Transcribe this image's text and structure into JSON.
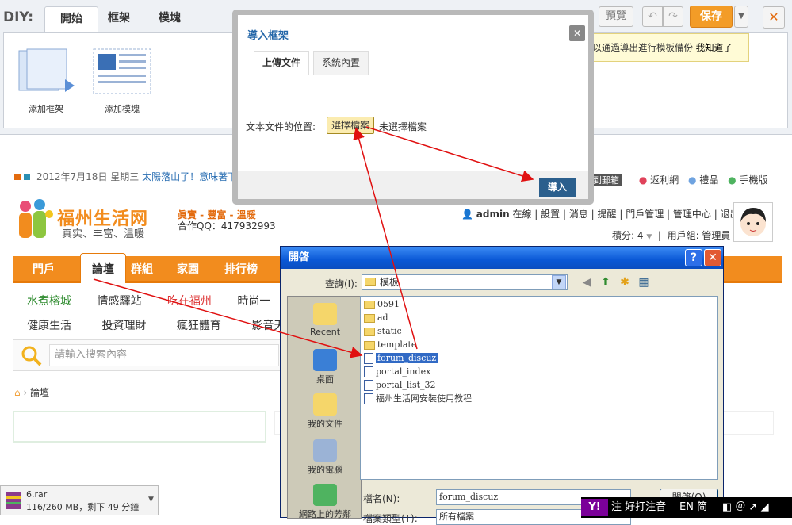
{
  "diy": {
    "label": "DIY:",
    "tabs": [
      "開始",
      "框架",
      "模塊"
    ],
    "items": [
      "添加框架",
      "添加模塊"
    ],
    "preview": "預覽",
    "save": "保存",
    "tip_text": "可以通過導出進行模板備份",
    "tip_link": "我知道了"
  },
  "site": {
    "date": "2012年7月18日 星期三",
    "date_msg": "太陽落山了！意味著下",
    "mailbox": "回到郵箱",
    "toplinks": [
      "返利網",
      "禮品",
      "手機版"
    ],
    "logo_text": "福州生活网",
    "logo_sub": "真实、丰富、温暖",
    "slogan": "眞實 - 豐富 - 溫暖",
    "qq": "合作QQ：417932993",
    "user": "admin",
    "online": "在線",
    "user_links": [
      "設置",
      "消息",
      "提醒",
      "門戶管理",
      "管理中心",
      "退出"
    ],
    "points": "積分: 4",
    "group": "用戶組: 管理員",
    "nav": [
      "門戶",
      "論壇",
      "群組",
      "家園",
      "排行榜"
    ],
    "subnav1": [
      "水煮榕城",
      "情感驛站",
      "吃在福州",
      "時尚一"
    ],
    "subnav2": [
      "健康生活",
      "投資理財",
      "瘋狂體育",
      "影音天"
    ],
    "search_placeholder": "請輸入搜索內容",
    "breadcrumb": "論壇"
  },
  "import_dialog": {
    "title": "導入框架",
    "tabs": [
      "上傳文件",
      "系統內置"
    ],
    "label": "文本文件的位置:",
    "choose": "選擇檔案",
    "no_file": "未選擇檔案",
    "import": "導入"
  },
  "open_dialog": {
    "title": "開啓",
    "look_in_label": "查詢(I):",
    "look_in": "模板",
    "places": [
      "Recent",
      "桌面",
      "我的文件",
      "我的電腦",
      "網路上的芳鄰"
    ],
    "files": [
      "0591",
      "ad",
      "static",
      "template",
      "forum_discuz",
      "portal_index",
      "portal_list_32",
      "福州生活网安裝使用教程"
    ],
    "filename_label": "檔名(N):",
    "filename": "forum_discuz",
    "filetype_label": "檔案類型(T):",
    "filetype": "所有檔案",
    "open_btn": "開啓(O)"
  },
  "download": {
    "name": "6.rar",
    "status": "116/260 MB，剩下 49 分鐘"
  },
  "taskbar": {
    "yahoo": "Y!",
    "items": "注 好打注音",
    "lang": "EN 简"
  },
  "colors": {
    "accent": "#f28c1e",
    "link": "#2366a8",
    "arrow": "#e01010"
  }
}
